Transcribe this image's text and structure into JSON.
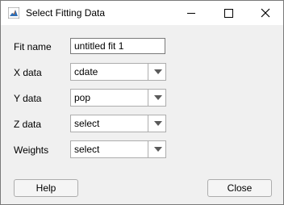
{
  "window": {
    "title": "Select Fitting Data",
    "app_icon": "matlab-peaks-icon",
    "controls": {
      "minimize": "minimize-icon",
      "maximize": "maximize-icon",
      "close": "close-x-icon"
    }
  },
  "form": {
    "fit_name": {
      "label": "Fit name",
      "value": "untitled fit 1"
    },
    "x_data": {
      "label": "X data",
      "value": "cdate"
    },
    "y_data": {
      "label": "Y data",
      "value": "pop"
    },
    "z_data": {
      "label": "Z data",
      "value": "select"
    },
    "weights": {
      "label": "Weights",
      "value": "select"
    }
  },
  "buttons": {
    "help": "Help",
    "close": "Close"
  }
}
